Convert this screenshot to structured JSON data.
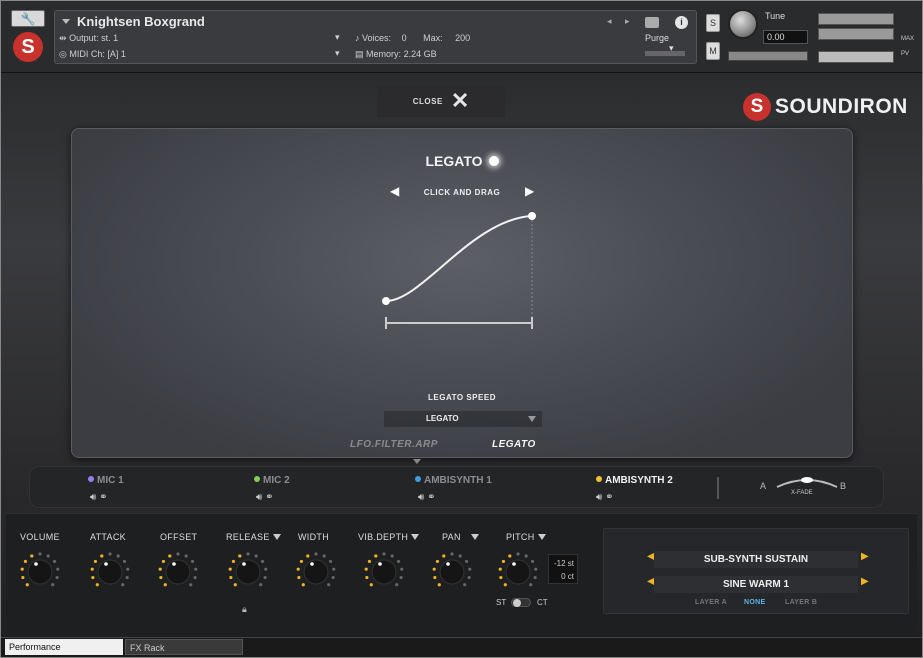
{
  "header": {
    "instrument_name": "Knightsen Boxgrand",
    "output_label": "Output:",
    "output_value": "st. 1",
    "midi_label": "MIDI Ch:",
    "midi_value": "[A]  1",
    "voices_label": "Voices:",
    "voices_value": "0",
    "max_label": "Max:",
    "max_value": "200",
    "memory_label": "Memory:",
    "memory_value": "2.24 GB",
    "purge_label": "Purge",
    "solo_label": "S",
    "mute_label": "M",
    "tune_label": "Tune",
    "tune_value": "0.00",
    "meter_left_label": "MAX",
    "meter_right_label": "PV"
  },
  "brand": {
    "logo_letter": "S",
    "name": "SOUNDIRON"
  },
  "close": {
    "label": "CLOSE"
  },
  "popup": {
    "title": "LEGATO",
    "drag_hint": "CLICK AND DRAG",
    "speed_label": "LEGATO SPEED",
    "speed_value": "LEGATO",
    "tabs": [
      "LFO.FILTER.ARP",
      "LEGATO"
    ],
    "active_tab": "LEGATO"
  },
  "mics": [
    {
      "name": "MIC 1",
      "color": "#9a7cf0",
      "active": false
    },
    {
      "name": "MIC 2",
      "color": "#7ecf5c",
      "active": false
    },
    {
      "name": "AMBISYNTH 1",
      "color": "#3aa0e0",
      "active": false
    },
    {
      "name": "AMBISYNTH 2",
      "color": "#f0c030",
      "active": true
    }
  ],
  "xfade": {
    "a": "A",
    "b": "B",
    "label": "X-FADE"
  },
  "controls": {
    "volume": "VOLUME",
    "attack": "ATTACK",
    "offset": "OFFSET",
    "release": "RELEASE",
    "width": "WIDTH",
    "vib_depth": "VIB.DEPTH",
    "pan": "PAN",
    "pitch": "PITCH",
    "pitch_st": "-12 st",
    "pitch_ct": "0 ct",
    "st_label": "ST",
    "ct_label": "CT"
  },
  "layers": {
    "layer_a_preset": "SUB-SYNTH SUSTAIN",
    "layer_b_preset": "SINE WARM 1",
    "options": [
      "LAYER A",
      "NONE",
      "LAYER B"
    ],
    "selected": "NONE"
  },
  "bottom_tabs": [
    "Performance",
    "FX Rack"
  ],
  "colors": {
    "brand_red": "#c8322d",
    "accent_yellow": "#f0b321",
    "accent_blue": "#5ab6ea"
  }
}
